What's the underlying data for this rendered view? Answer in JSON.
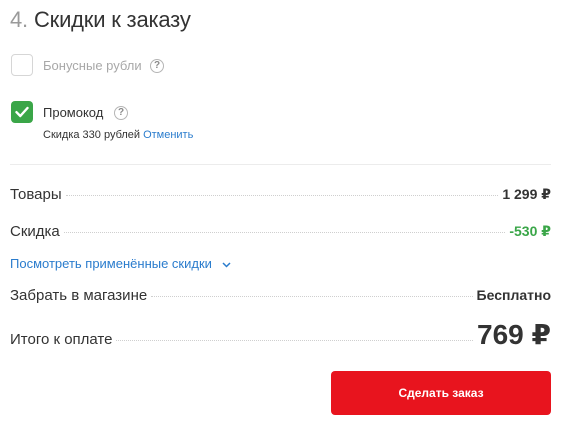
{
  "section": {
    "number": "4.",
    "title": "Скидки к заказу"
  },
  "options": {
    "bonus": {
      "label": "Бонусные рубли",
      "checked": false,
      "help": "?"
    },
    "promo": {
      "label": "Промокод",
      "checked": true,
      "help": "?",
      "note": "Скидка 330 рублей",
      "cancel_label": "Отменить"
    }
  },
  "summary": {
    "goods_label": "Товары",
    "goods_value": "1 299 ₽",
    "discount_label": "Скидка",
    "discount_value": "-530 ₽",
    "applied_discounts_link": "Посмотреть применённые скидки",
    "pickup_label": "Забрать в магазине",
    "pickup_value": "Бесплатно",
    "total_label": "Итого к оплате",
    "total_value": "769 ₽"
  },
  "actions": {
    "submit_label": "Сделать заказ"
  },
  "colors": {
    "accent_green": "#3aa648",
    "link_blue": "#2a7ccd",
    "button_red": "#e8141e"
  }
}
